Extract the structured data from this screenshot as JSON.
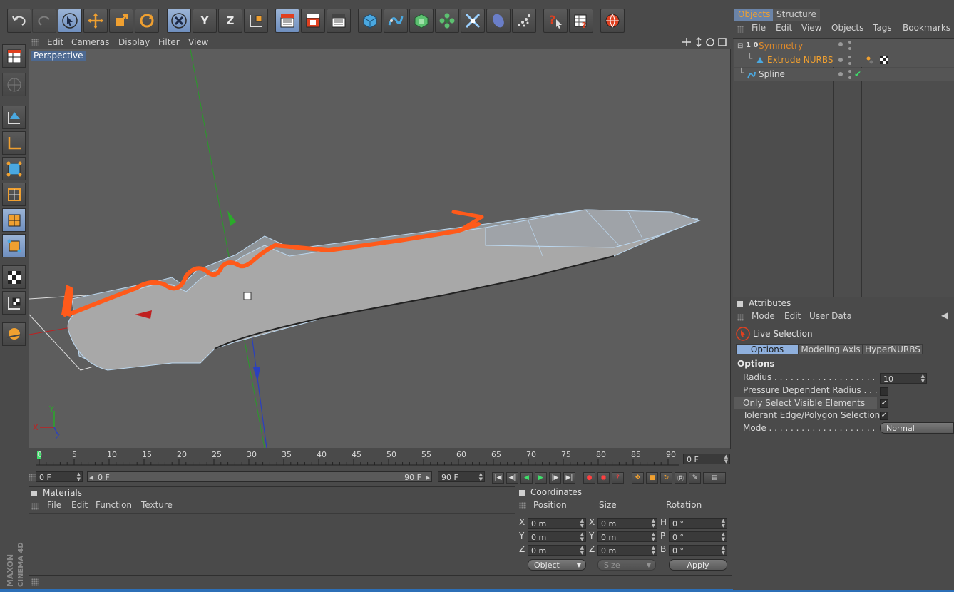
{
  "viewport": {
    "menu": [
      "Edit",
      "Cameras",
      "Display",
      "Filter",
      "View"
    ],
    "label": "Perspective",
    "axis_x": "X",
    "axis_y": "Y",
    "axis_z": "Z"
  },
  "toolbar": {
    "axis_x": "X",
    "axis_y": "Y",
    "axis_z": "Z"
  },
  "timeline": {
    "ticks": [
      "0",
      "5",
      "10",
      "15",
      "20",
      "25",
      "30",
      "35",
      "40",
      "45",
      "50",
      "55",
      "60",
      "65",
      "70",
      "75",
      "80",
      "85",
      "90"
    ],
    "current_frame": "0 F",
    "start_field": "0 F",
    "slider_start": "0 F",
    "slider_end": "90 F",
    "end_field": "90 F"
  },
  "materials": {
    "title": "Materials",
    "menu": [
      "File",
      "Edit",
      "Function",
      "Texture"
    ]
  },
  "coordinates": {
    "title": "Coordinates",
    "headers": [
      "Position",
      "Size",
      "Rotation"
    ],
    "pos_labels": [
      "X",
      "Y",
      "Z"
    ],
    "pos_values": [
      "0 m",
      "0 m",
      "0 m"
    ],
    "size_labels": [
      "X",
      "Y",
      "Z"
    ],
    "size_values": [
      "0 m",
      "0 m",
      "0 m"
    ],
    "rot_labels": [
      "H",
      "P",
      "B"
    ],
    "rot_values": [
      "0 °",
      "0 °",
      "0 °"
    ],
    "mode_select": "Object",
    "size_select": "Size",
    "apply_label": "Apply"
  },
  "objects": {
    "tabs": [
      "Objects",
      "Structure"
    ],
    "menu": [
      "File",
      "Edit",
      "View",
      "Objects",
      "Tags",
      "Bookmarks"
    ],
    "tree": [
      {
        "name": "Symmetry",
        "color": "#e08a2a",
        "indent": 0,
        "badge": "1 0"
      },
      {
        "name": "Extrude NURBS",
        "color": "#f0a030",
        "indent": 1
      },
      {
        "name": "Spline",
        "color": "#d8d8d8",
        "indent": 0
      }
    ]
  },
  "attributes": {
    "title": "Attributes",
    "menu": [
      "Mode",
      "Edit",
      "User Data"
    ],
    "tool_name": "Live Selection",
    "tabs": [
      "Options",
      "Modeling Axis",
      "HyperNURBS"
    ],
    "section": "Options",
    "rows": [
      {
        "label": "Radius . . . . . . . . . . . . . . . . . . . . . . . . . .",
        "value": "10",
        "type": "number"
      },
      {
        "label": "Pressure Dependent Radius . . . .",
        "value": "",
        "type": "check",
        "checked": false
      },
      {
        "label": "Only Select Visible Elements",
        "value": "✓",
        "type": "check",
        "checked": true
      },
      {
        "label": "Tolerant Edge/Polygon Selection",
        "value": "✓",
        "type": "check",
        "checked": true
      },
      {
        "label": "Mode . . . . . . . . . . . . . . . . . . . . . . . . . . .",
        "value": "Normal",
        "type": "select"
      }
    ]
  },
  "branding": {
    "logo": "MAXON CINEMA 4D"
  },
  "colors": {
    "accent": "#6f8fbf",
    "orange_stroke": "#ff5a1a",
    "selected_tab": "#6b84a8"
  }
}
